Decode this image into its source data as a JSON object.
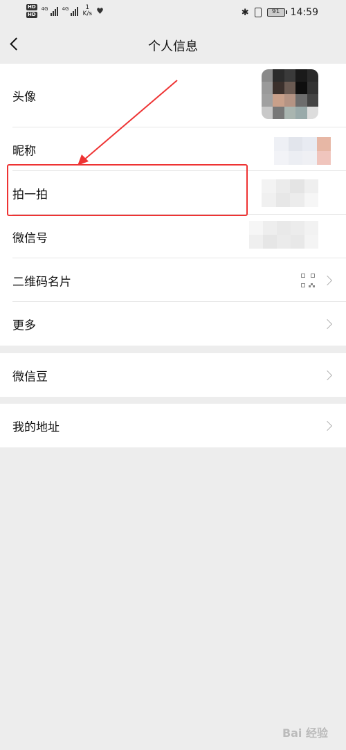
{
  "status_bar": {
    "hd_badges": [
      "HD",
      "HD"
    ],
    "network": [
      "4G",
      "4G"
    ],
    "speed_value": "1",
    "speed_unit": "K/s",
    "battery": "91",
    "time": "14:59"
  },
  "nav": {
    "title": "个人信息"
  },
  "groups": [
    {
      "items": [
        {
          "label": "头像"
        },
        {
          "label": "昵称"
        },
        {
          "label": "拍一拍"
        },
        {
          "label": "微信号"
        },
        {
          "label": "二维码名片"
        },
        {
          "label": "更多"
        }
      ]
    },
    {
      "items": [
        {
          "label": "微信豆"
        }
      ]
    },
    {
      "items": [
        {
          "label": "我的地址"
        }
      ]
    }
  ],
  "colors": {
    "highlight": "#e33333",
    "background": "#ededed",
    "separator": "#e6e6e6"
  },
  "icons": [
    "back-icon",
    "chevron-right-icon",
    "qr-code-icon",
    "bluetooth-icon",
    "vibrate-icon",
    "battery-icon",
    "heart-pulse-icon"
  ],
  "watermark": "Bai 经验"
}
